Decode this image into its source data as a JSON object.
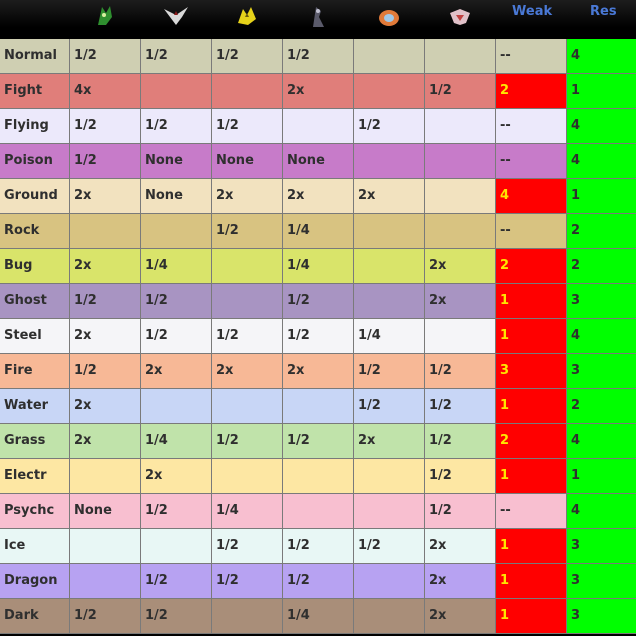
{
  "header": {
    "icons": [
      {
        "name": "grass-pokemon-sprite-icon",
        "color": "#2f8f2f"
      },
      {
        "name": "flying-pokemon-sprite-icon",
        "color": "#d9d9d9"
      },
      {
        "name": "electric-pokemon-sprite-icon",
        "color": "#e6d21a"
      },
      {
        "name": "dark-pokemon-sprite-icon",
        "color": "#5a5a6a"
      },
      {
        "name": "water-pokemon-sprite-icon",
        "color": "#e07a3a"
      },
      {
        "name": "fighting-pokemon-sprite-icon",
        "color": "#e0c0c8"
      }
    ],
    "weak_label": "Weak",
    "res_label": "Res"
  },
  "colors": {
    "weak_highlight": "#ff0000",
    "res_bg": "#00ff00",
    "header_text": "#4a79d6",
    "weak_text": "#ffe600"
  },
  "rows": [
    {
      "type": "Normal",
      "bg": "#cfcfb2",
      "cells": [
        "1/2",
        "1/2",
        "1/2",
        "1/2",
        "",
        ""
      ],
      "weak": "--",
      "weak_hl": false,
      "res": "4"
    },
    {
      "type": "Fight",
      "bg": "#e07e7a",
      "cells": [
        "4x",
        "",
        "",
        "2x",
        "",
        "1/2"
      ],
      "weak": "2",
      "weak_hl": true,
      "res": "1"
    },
    {
      "type": "Flying",
      "bg": "#ece9fb",
      "cells": [
        "1/2",
        "1/2",
        "1/2",
        "",
        "1/2",
        ""
      ],
      "weak": "--",
      "weak_hl": false,
      "res": "4"
    },
    {
      "type": "Poison",
      "bg": "#c77bc9",
      "cells": [
        "1/2",
        "None",
        "None",
        "None",
        "",
        ""
      ],
      "weak": "--",
      "weak_hl": false,
      "res": "4"
    },
    {
      "type": "Ground",
      "bg": "#f2e2bf",
      "cells": [
        "2x",
        "None",
        "2x",
        "2x",
        "2x",
        ""
      ],
      "weak": "4",
      "weak_hl": true,
      "res": "1"
    },
    {
      "type": "Rock",
      "bg": "#d8c381",
      "cells": [
        "",
        "",
        "1/2",
        "1/4",
        "",
        ""
      ],
      "weak": "--",
      "weak_hl": false,
      "res": "2"
    },
    {
      "type": "Bug",
      "bg": "#d9e46a",
      "cells": [
        "2x",
        "1/4",
        "",
        "1/4",
        "",
        "2x"
      ],
      "weak": "2",
      "weak_hl": true,
      "res": "2"
    },
    {
      "type": "Ghost",
      "bg": "#a894c2",
      "cells": [
        "1/2",
        "1/2",
        "",
        "1/2",
        "",
        "2x"
      ],
      "weak": "1",
      "weak_hl": true,
      "res": "3"
    },
    {
      "type": "Steel",
      "bg": "#f5f5f8",
      "cells": [
        "2x",
        "1/2",
        "1/2",
        "1/2",
        "1/4",
        ""
      ],
      "weak": "1",
      "weak_hl": true,
      "res": "4"
    },
    {
      "type": "Fire",
      "bg": "#f7b896",
      "cells": [
        "1/2",
        "2x",
        "2x",
        "2x",
        "1/2",
        "1/2"
      ],
      "weak": "3",
      "weak_hl": true,
      "res": "3"
    },
    {
      "type": "Water",
      "bg": "#c8d6f6",
      "cells": [
        "2x",
        "",
        "",
        "",
        "1/2",
        "1/2"
      ],
      "weak": "1",
      "weak_hl": true,
      "res": "2"
    },
    {
      "type": "Grass",
      "bg": "#c0e3aa",
      "cells": [
        "2x",
        "1/4",
        "1/2",
        "1/2",
        "2x",
        "1/2"
      ],
      "weak": "2",
      "weak_hl": true,
      "res": "4"
    },
    {
      "type": "Electr",
      "bg": "#fde7a3",
      "cells": [
        "",
        "2x",
        "",
        "",
        "",
        "1/2"
      ],
      "weak": "1",
      "weak_hl": true,
      "res": "1"
    },
    {
      "type": "Psychc",
      "bg": "#f8bfd0",
      "cells": [
        "None",
        "1/2",
        "1/4",
        "",
        "",
        "1/2"
      ],
      "weak": "--",
      "weak_hl": false,
      "res": "4"
    },
    {
      "type": "Ice",
      "bg": "#e8f7f5",
      "cells": [
        "",
        "",
        "1/2",
        "1/2",
        "1/2",
        "2x"
      ],
      "weak": "1",
      "weak_hl": true,
      "res": "3"
    },
    {
      "type": "Dragon",
      "bg": "#b7a2f2",
      "cells": [
        "",
        "1/2",
        "1/2",
        "1/2",
        "",
        "2x"
      ],
      "weak": "1",
      "weak_hl": true,
      "res": "3"
    },
    {
      "type": "Dark",
      "bg": "#a98e79",
      "cells": [
        "1/2",
        "1/2",
        "",
        "1/4",
        "",
        "2x"
      ],
      "weak": "1",
      "weak_hl": true,
      "res": "3"
    }
  ]
}
